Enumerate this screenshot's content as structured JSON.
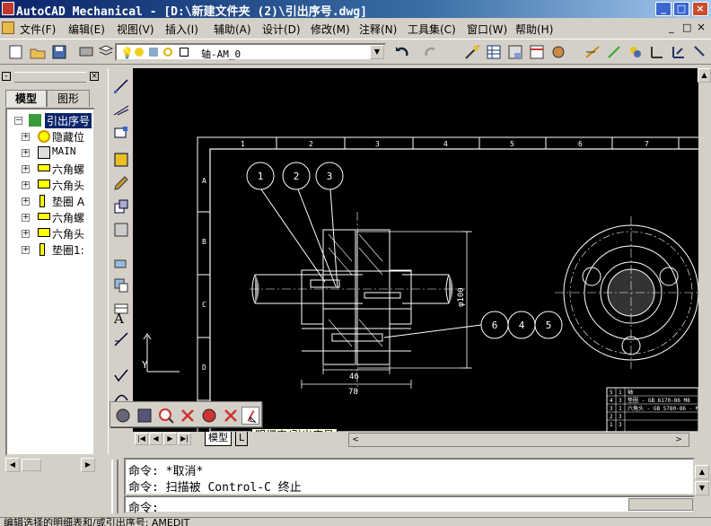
{
  "window": {
    "title": "AutoCAD Mechanical - [D:\\新建文件夹 (2)\\引出序号.dwg]",
    "minimize": "_",
    "maximize": "□",
    "close": "×"
  },
  "menu": {
    "items": [
      "文件(F)",
      "编辑(E)",
      "视图(V)",
      "插入(I)",
      "辅助(A)",
      "设计(D)",
      "修改(M)",
      "注释(N)",
      "工具集(C)",
      "窗口(W)",
      "帮助(H)"
    ]
  },
  "toolbar": {
    "layer_value": "轴-AM_0"
  },
  "left_panel": {
    "tabs": [
      "模型",
      "图形"
    ],
    "tree": {
      "root": "引出序号",
      "children": [
        "隐藏位",
        "MAIN",
        "六角螺",
        "六角头",
        "垫圈 A",
        "六角螺",
        "六角头",
        "垫圈1:"
      ]
    }
  },
  "layout_tabs": {
    "model": "模型",
    "layout": "L"
  },
  "tooltip": "明细表/引出序号",
  "drawing": {
    "balloons": [
      "1",
      "2",
      "3",
      "6",
      "4",
      "5"
    ],
    "border_numbers": [
      "1",
      "2",
      "3",
      "4",
      "5",
      "6",
      "7"
    ],
    "border_letters": [
      "A",
      "B",
      "C",
      "D",
      "E"
    ],
    "dimensions": {
      "width_46": "46",
      "width_78": "78",
      "dia_100": "φ100"
    },
    "ucs_y": "Y",
    "bom_rows": [
      {
        "item": "5",
        "qty": "1",
        "desc": "轴"
      },
      {
        "item": "4",
        "qty": "3",
        "desc": "垫圈 - GB 6170-86 M8"
      },
      {
        "item": "3",
        "qty": "1",
        "desc": "六角头 - GB 5780-86 - M6x35"
      },
      {
        "item": "2",
        "qty": "3",
        "desc": ""
      },
      {
        "item": "1",
        "qty": "3",
        "desc": ""
      }
    ]
  },
  "command": {
    "line1": "命令: *取消*",
    "line2": "命令: 扫描被 Control-C 终止",
    "prompt": "命令:"
  },
  "statusbar": {
    "text": "编辑选择的明细表和/或引出序号: AMEDIT"
  }
}
